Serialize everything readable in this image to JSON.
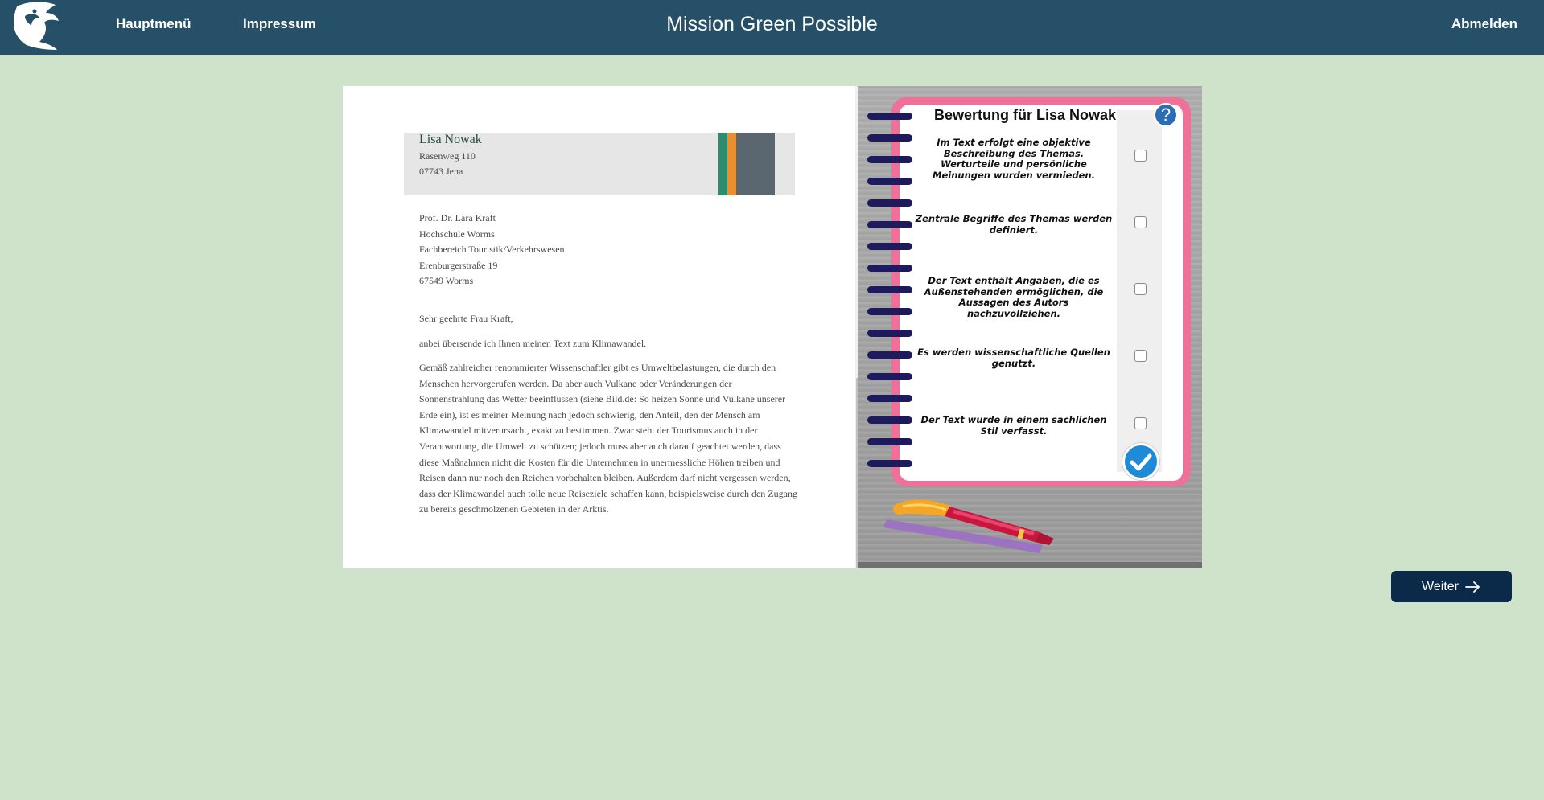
{
  "navbar": {
    "home_label": "Hauptmenü",
    "impressum_label": "Impressum",
    "title": "Mission Green Possible",
    "logout_label": "Abmelden",
    "background_color": "#264f68"
  },
  "letter": {
    "sender": {
      "name": "Lisa Nowak",
      "street": "Rasenweg 110",
      "city": "07743 Jena"
    },
    "recipient": [
      "Prof. Dr. Lara Kraft",
      "Hochschule Worms",
      "Fachbereich Touristik/Verkehrswesen",
      "Erenburgerstraße 19",
      "67549 Worms"
    ],
    "salutation": "Sehr geehrte Frau Kraft,",
    "intro": "anbei übersende ich Ihnen meinen Text zum Klimawandel.",
    "body": "Gemäß zahlreicher renommierter Wissenschaftler gibt es Umweltbelastungen, die durch den Menschen hervorgerufen werden. Da aber auch Vulkane oder Veränderungen der Sonnenstrahlung das Wetter beeinflussen (siehe Bild.de: So heizen Sonne und Vulkane unserer Erde ein), ist es meiner Meinung nach jedoch schwierig, den Anteil, den der Mensch am Klimawandel mitverursacht, exakt zu bestimmen. Zwar steht der Tourismus auch in der Verantwortung, die Umwelt zu schützen; jedoch muss aber auch darauf geachtet werden, dass diese Maßnahmen nicht die Kosten für die Unternehmen in unermessliche Höhen treiben und Reisen dann nur noch den Reichen vorbehalten bleiben. Außerdem darf nicht vergessen werden, dass der Klimawandel auch tolle neue Reiseziele schaffen kann, beispielsweise durch den Zugang zu bereits geschmolzenen Gebieten in der Arktis."
  },
  "evaluation": {
    "title": "Bewertung für Lisa Nowak",
    "help_icon": "?",
    "criteria": [
      {
        "text": "Im Text erfolgt eine objektive Beschreibung des Themas. Werturteile und persönliche Meinungen wurden vermieden.",
        "checked": false
      },
      {
        "text": "Zentrale Begriffe des Themas werden definiert.",
        "checked": false
      },
      {
        "text": "Der Text enthält Angaben, die es Außenstehenden ermöglichen, die Aussagen des Autors nachzuvollziehen.",
        "checked": false
      },
      {
        "text": "Es werden wissenschaftliche Quellen genutzt.",
        "checked": false
      },
      {
        "text": "Der Text wurde in einem sachlichen Stil verfasst.",
        "checked": false
      }
    ],
    "frame_color": "#ef7199",
    "ring_color": "#1d1b5e",
    "submit_icon": "check-icon"
  },
  "next_button": {
    "label": "Weiter",
    "icon": "arrow-right-icon"
  }
}
